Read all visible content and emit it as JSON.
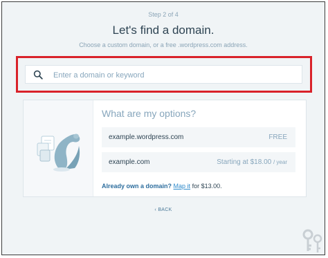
{
  "header": {
    "step": "Step 2 of 4",
    "title": "Let's find a domain.",
    "subtitle": "Choose a custom domain, or a free .wordpress.com address."
  },
  "search": {
    "placeholder": "Enter a domain or keyword",
    "value": ""
  },
  "options": {
    "title": "What are my options?",
    "rows": [
      {
        "domain": "example.wordpress.com",
        "price": "FREE",
        "per": ""
      },
      {
        "domain": "example.com",
        "price": "Starting at $18.00",
        "per": "/ year"
      }
    ],
    "own_prefix": "Already own a domain?",
    "own_link": "Map it",
    "own_suffix": "for $13.00."
  },
  "nav": {
    "back": "BACK"
  },
  "colors": {
    "highlight": "#d9222a",
    "accent": "#2e8acb",
    "text": "#2e4453",
    "muted": "#87a6bc"
  },
  "icons": [
    "search-icon",
    "plant-illustration",
    "back-arrow-icon",
    "keys-icon"
  ]
}
